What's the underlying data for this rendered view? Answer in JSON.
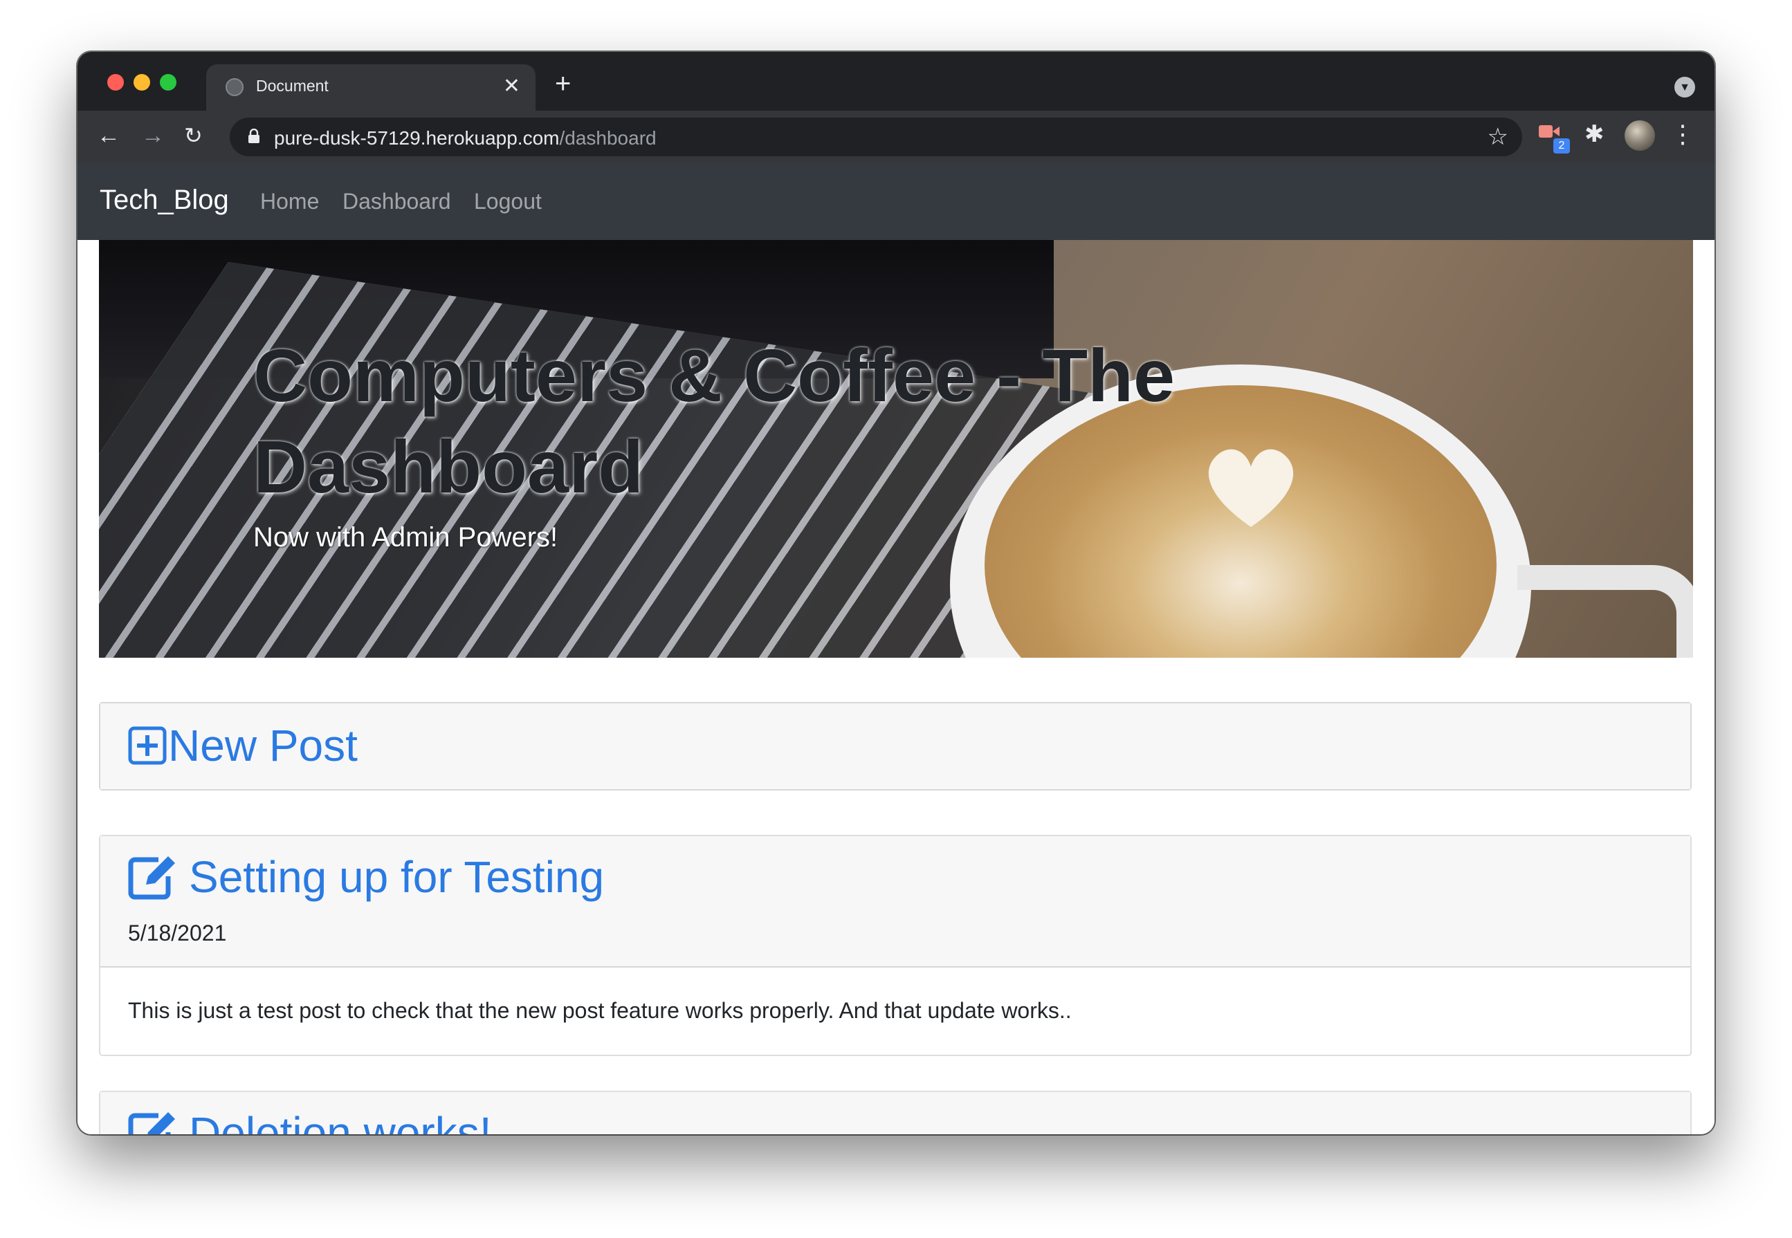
{
  "browser": {
    "tab_title": "Document",
    "tab_close": "✕",
    "new_tab": "+",
    "url_host": "pure-dusk-57129.herokuapp.com",
    "url_path": "/dashboard",
    "extension_badge": "2",
    "icons": [
      "back-arrow-icon",
      "forward-arrow-icon",
      "reload-icon",
      "lock-icon",
      "star-icon",
      "puzzle-icon",
      "kebab-menu-icon"
    ]
  },
  "navbar": {
    "brand": "Tech_Blog",
    "links": [
      "Home",
      "Dashboard",
      "Logout"
    ]
  },
  "hero": {
    "title": "Computers & Coffee - The Dashboard",
    "subtitle": "Now with Admin Powers!"
  },
  "new_post": {
    "label": "New Post"
  },
  "posts": [
    {
      "title": "Setting up for Testing",
      "date": "5/18/2021",
      "body": "This is just a test post to check that the new post feature works properly. And that update works.."
    },
    {
      "title": "Deletion works!"
    }
  ],
  "colors": {
    "link": "#2a7ae2",
    "navbar": "#343a40",
    "chrome_dark": "#202124"
  }
}
